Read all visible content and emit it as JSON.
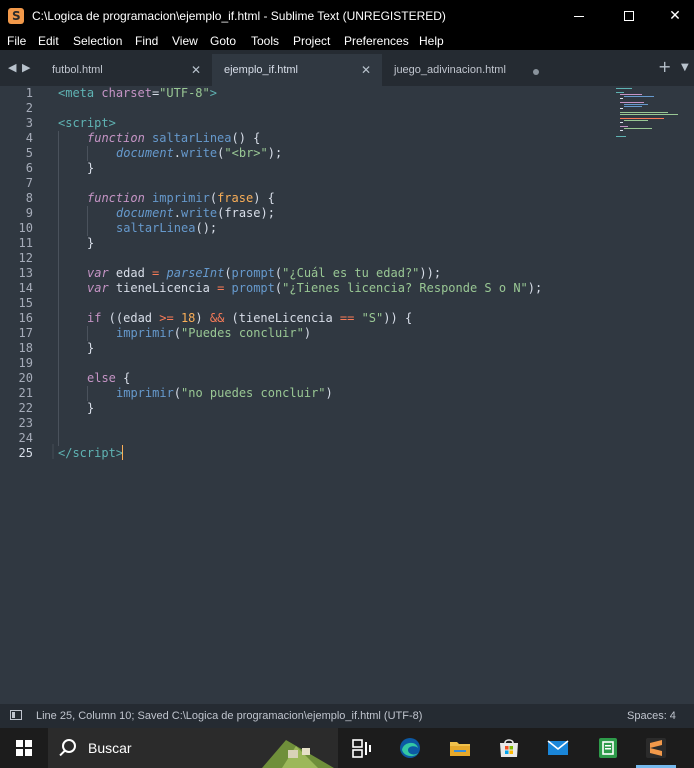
{
  "window": {
    "title": "C:\\Logica de programacion\\ejemplo_if.html - Sublime Text (UNREGISTERED)"
  },
  "menu": {
    "items": [
      "File",
      "Edit",
      "Selection",
      "Find",
      "View",
      "Goto",
      "Tools",
      "Project",
      "Preferences",
      "Help"
    ]
  },
  "tabs": {
    "items": [
      {
        "label": "futbol.html"
      },
      {
        "label": "ejemplo_if.html"
      },
      {
        "label": "juego_adivinacion.html"
      }
    ]
  },
  "editor": {
    "line_numbers": [
      "1",
      "2",
      "3",
      "4",
      "5",
      "6",
      "7",
      "8",
      "9",
      "10",
      "11",
      "12",
      "13",
      "14",
      "15",
      "16",
      "17",
      "18",
      "19",
      "20",
      "21",
      "22",
      "23",
      "24",
      "25"
    ],
    "current_line": "25"
  },
  "code": {
    "l1": {
      "a": "<",
      "b": "meta",
      "c": " charset",
      "d": "=",
      "e": "\"UTF-8\"",
      "f": ">"
    },
    "l3": {
      "a": "<",
      "b": "script",
      "c": ">"
    },
    "l4": {
      "a": "function",
      "b": " saltarLinea",
      "c": "() {"
    },
    "l5": {
      "a": "document",
      "b": ".",
      "c": "write",
      "d": "(",
      "e": "\"<br>\"",
      "f": ");"
    },
    "l6": {
      "a": "}"
    },
    "l8": {
      "a": "function",
      "b": " imprimir",
      "c": "(",
      "d": "frase",
      "e": ") {"
    },
    "l9": {
      "a": "document",
      "b": ".",
      "c": "write",
      "d": "(frase);"
    },
    "l10": {
      "a": "saltarLinea",
      "b": "();"
    },
    "l11": {
      "a": "}"
    },
    "l13": {
      "a": "var",
      "b": " edad ",
      "c": "=",
      "d": " ",
      "e": "parseInt",
      "f": "(",
      "g": "prompt",
      "h": "(",
      "i": "\"¿Cuál es tu edad?\"",
      "j": "));"
    },
    "l14": {
      "a": "var",
      "b": " tieneLicencia ",
      "c": "=",
      "d": " ",
      "e": "prompt",
      "f": "(",
      "g": "\"¿Tienes licencia? Responde S o N\"",
      "h": ");"
    },
    "l16": {
      "a": "if",
      "b": " ((edad ",
      "c": ">=",
      "d": " ",
      "e": "18",
      "f": ") ",
      "g": "&&",
      "h": " (tieneLicencia ",
      "i": "==",
      "j": " ",
      "k": "\"S\"",
      "l": ")) {"
    },
    "l17": {
      "a": "imprimir",
      "b": "(",
      "c": "\"Puedes concluir\"",
      "d": ")"
    },
    "l18": {
      "a": "}"
    },
    "l20": {
      "a": "else",
      "b": " {"
    },
    "l21": {
      "a": "imprimir",
      "b": "(",
      "c": "\"no puedes concluir\"",
      "d": ")"
    },
    "l22": {
      "a": "}"
    },
    "l25": {
      "a": "</",
      "b": "script",
      "c": ">"
    }
  },
  "status": {
    "text": "Line 25, Column 10; Saved C:\\Logica de programacion\\ejemplo_if.html (UTF-8)",
    "spaces": "Spaces: 4"
  },
  "taskbar": {
    "search_label": "Buscar"
  },
  "colors": {
    "editor_bg": "#303841",
    "tag": "#5fb3b3",
    "keyword": "#c594c5",
    "string": "#99c794",
    "function": "#6699cc",
    "operator": "#f97b58",
    "number": "#f9ae58"
  },
  "icons": {
    "app": "sublime-text-icon",
    "search": "search-icon",
    "taskbar": [
      "windows-start-icon",
      "task-view-icon",
      "edge-icon",
      "file-explorer-icon",
      "microsoft-store-icon",
      "mail-icon",
      "notes-icon",
      "sublime-text-icon"
    ]
  }
}
